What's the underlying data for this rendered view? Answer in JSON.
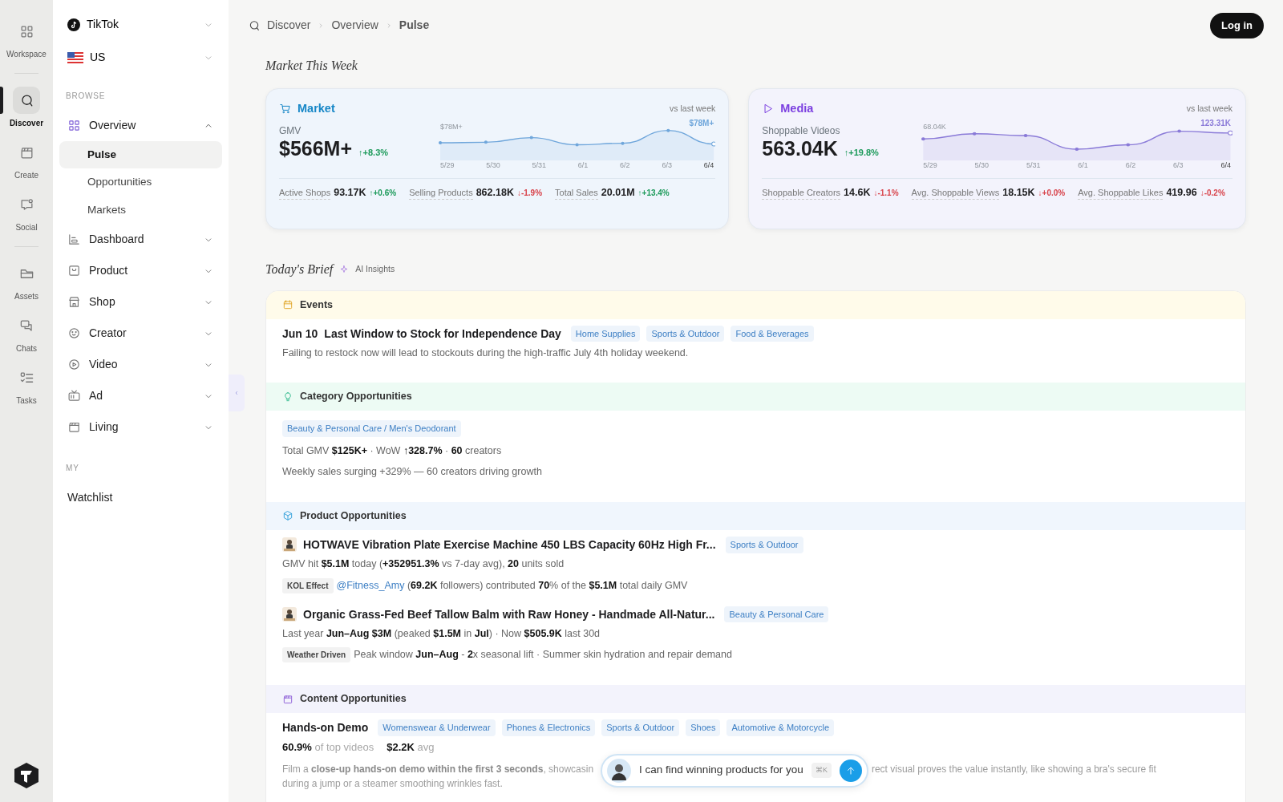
{
  "rail": {
    "groups": [
      [
        {
          "label": "Workspace",
          "selected": false
        }
      ],
      [
        {
          "label": "Discover",
          "selected": true
        },
        {
          "label": "Create",
          "selected": false
        },
        {
          "label": "Social",
          "selected": false
        }
      ],
      [
        {
          "label": "Assets",
          "selected": false
        },
        {
          "label": "Chats",
          "selected": false
        },
        {
          "label": "Tasks",
          "selected": false
        }
      ]
    ]
  },
  "sidebar": {
    "platform": "TikTok",
    "region": "US",
    "sections": [
      {
        "heading": "BROWSE",
        "items": [
          {
            "label": "Overview",
            "expanded": true,
            "children": [
              {
                "label": "Pulse",
                "selected": true
              },
              {
                "label": "Opportunities",
                "selected": false
              },
              {
                "label": "Markets",
                "selected": false
              }
            ]
          },
          {
            "label": "Dashboard",
            "expanded": false
          },
          {
            "label": "Product",
            "expanded": false
          },
          {
            "label": "Shop",
            "expanded": false
          },
          {
            "label": "Creator",
            "expanded": false
          },
          {
            "label": "Video",
            "expanded": false
          },
          {
            "label": "Ad",
            "expanded": false
          },
          {
            "label": "Living",
            "expanded": false
          }
        ]
      },
      {
        "heading": "MY",
        "items": [
          {
            "label": "Watchlist"
          }
        ]
      }
    ]
  },
  "breadcrumb": [
    "Discover",
    "Overview",
    "Pulse"
  ],
  "login": "Log in",
  "market_title": "Market This Week",
  "cards": [
    {
      "kind": "market",
      "title": "Market",
      "note": "vs last week",
      "metric_label": "GMV",
      "metric_value": "$566M+",
      "change": "↑+8.3%",
      "color": "#1c9a5a",
      "chart": {
        "start_label": "$78M+",
        "end_label": "$78M+",
        "dates": [
          "5/29",
          "5/30",
          "5/31",
          "6/1",
          "6/2",
          "6/3",
          "6/4"
        ]
      },
      "stats": [
        {
          "label": "Active Shops",
          "value": "93.17K",
          "change": "↑+0.6%",
          "color": "#1c9a5a"
        },
        {
          "label": "Selling Products",
          "value": "862.18K",
          "change": "↓-1.9%",
          "color": "#d8434b"
        },
        {
          "label": "Total Sales",
          "value": "20.01M",
          "change": "↑+13.4%",
          "color": "#1c9a5a"
        }
      ]
    },
    {
      "kind": "media",
      "title": "Media",
      "note": "vs last week",
      "metric_label": "Shoppable Videos",
      "metric_value": "563.04K",
      "change": "↑+19.8%",
      "color": "#1c9a5a",
      "chart": {
        "start_label": "68.04K",
        "end_label": "123.31K",
        "dates": [
          "5/29",
          "5/30",
          "5/31",
          "6/1",
          "6/2",
          "6/3",
          "6/4"
        ]
      },
      "stats": [
        {
          "label": "Shoppable Creators",
          "value": "14.6K",
          "change": "↓-1.1%",
          "color": "#d8434b"
        },
        {
          "label": "Avg. Shoppable Views",
          "value": "18.15K",
          "change": "↓+0.0%",
          "color": "#d8434b"
        },
        {
          "label": "Avg. Shoppable Likes",
          "value": "419.96",
          "change": "↓-0.2%",
          "color": "#d8434b"
        }
      ]
    }
  ],
  "brief": {
    "title": "Today's Brief",
    "badge": "AI Insights",
    "sections": [
      {
        "kind": "events",
        "title": "Events",
        "items": [
          {
            "date": "Jun 10",
            "title": "Last Window to Stock for Independence Day",
            "tags": [
              "Home Supplies",
              "Sports & Outdoor",
              "Food & Beverages"
            ],
            "lines": [
              {
                "text": "Failing to restock now will lead to stockouts during the high-traffic July 4th holiday weekend."
              }
            ]
          }
        ]
      },
      {
        "kind": "category",
        "title": "Category Opportunities",
        "items": [
          {
            "tags": [
              "Beauty & Personal Care / Men's Deodorant"
            ],
            "lines": [
              {
                "text": "Total GMV **$125K+** · WoW **↑328.7%** · **60** creators"
              },
              {
                "text": "Weekly sales surging +329% — 60 creators driving growth"
              }
            ]
          }
        ]
      },
      {
        "kind": "product",
        "title": "Product Opportunities",
        "items": [
          {
            "thumb": {
              "kind": "picture"
            },
            "title": "HOTWAVE Vibration Plate Exercise Machine 450 LBS Capacity 60Hz High Fr...",
            "tags": [
              "Sports & Outdoor"
            ],
            "lines": [
              {
                "text": "GMV hit **$5.1M** today (**+352951.3%** vs 7-day avg), **20** units sold"
              },
              {
                "chip": "KOL Effect",
                "link": "@Fitness_Amy",
                "text": "(**69.2K** followers) contributed **70**% of the **$5.1M** total daily GMV"
              }
            ]
          },
          {
            "thumb": {
              "kind": "picture"
            },
            "title": "Organic Grass-Fed Beef Tallow Balm with Raw Honey - Handmade All-Natur...",
            "tags": [
              "Beauty & Personal Care"
            ],
            "lines": [
              {
                "text": "Last year **Jun–Aug $3M** (peaked **$1.5M** in **Jul**) · Now **$505.9K** last 30d"
              },
              {
                "chip": "Weather Driven",
                "text": "Peak window **Jun–Aug** - **2**x seasonal lift · Summer skin hydration and repair demand"
              }
            ]
          }
        ]
      },
      {
        "kind": "content",
        "title": "Content Opportunities",
        "items": [
          {
            "title": "Hands-on Demo",
            "tags": [
              "Womenswear & Underwear",
              "Phones & Electronics",
              "Sports & Outdoor",
              "Shoes",
              "Automotive & Motorcycle"
            ],
            "stats": [
              "**60.9%** of top videos",
              "**$2.2K** avg"
            ],
            "faded": {
              "left": "Film a **close-up hands-on demo within the first 3 seconds**, showcasin",
              "right": "rect visual proves the value instantly, like showing a bra's secure fit",
              "second": "during a jump or a steamer smoothing wrinkles fast."
            }
          }
        ]
      }
    ]
  },
  "chat": {
    "placeholder": "I can find winning products for you",
    "shortcut": "⌘K"
  }
}
